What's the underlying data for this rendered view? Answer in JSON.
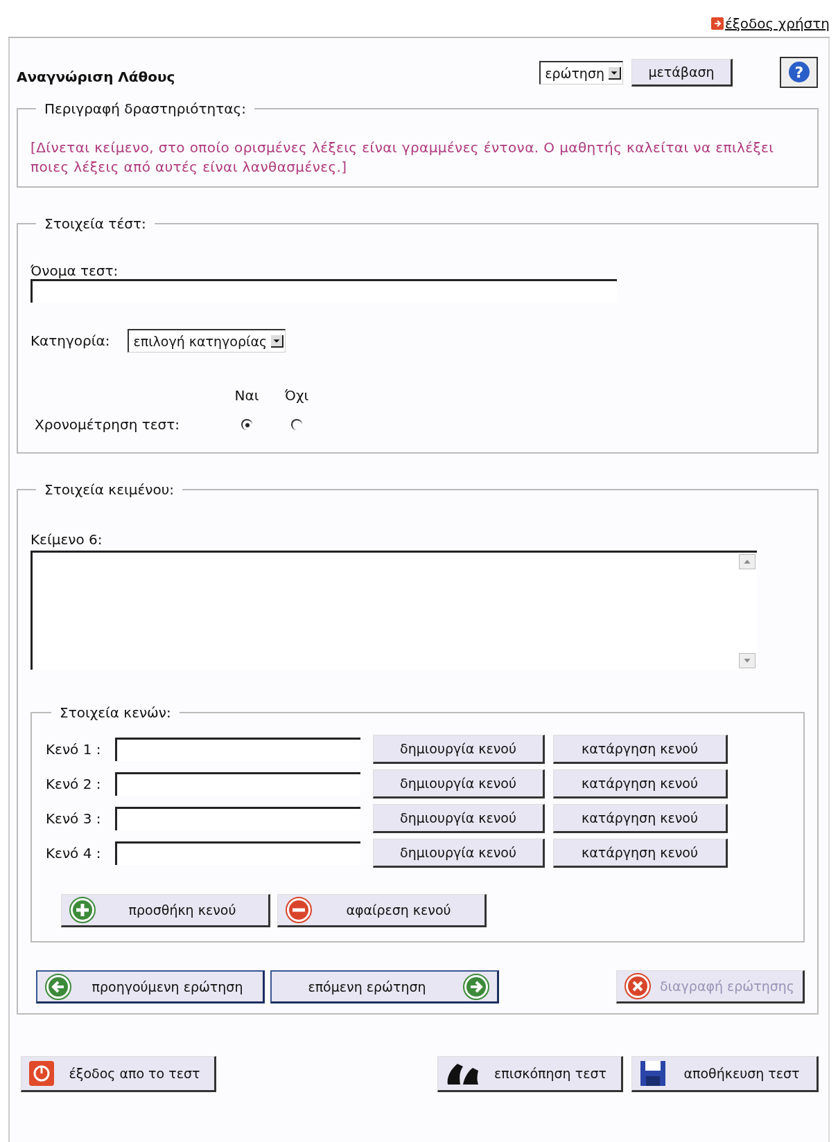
{
  "logout_link": "έξοδος χρήστη",
  "title": "Αναγνώριση Λάθους",
  "nav": {
    "select_value": "ερώτηση",
    "go_button": "μετάβαση",
    "help_button": "?"
  },
  "description": {
    "legend": "Περιγραφή δραστηριότητας:",
    "text": "[Δίνεται κείμενο, στο οποίο ορισμένες λέξεις είναι γραμμένες έντονα. Ο μαθητής καλείται να επιλέξει ποιες λέξεις από αυτές είναι λανθασμένες.]"
  },
  "test_details": {
    "legend": "Στοιχεία τέστ:",
    "name_label": "Όνομα τεστ:",
    "category_label": "Κατηγορία:",
    "category_value": "επιλογή κατηγορίας",
    "timing_label": "Χρονομέτρηση τεστ:",
    "timing_options": [
      {
        "label": "Ναι",
        "selected": true
      },
      {
        "label": "Όχι",
        "selected": false
      }
    ]
  },
  "text_details": {
    "legend": "Στοιχεία κειμένου:",
    "text_label": "Κείμενο 6:",
    "blanks": {
      "legend": "Στοιχεία κενών:",
      "rows": [
        {
          "label": "Κενό 1 :",
          "create": "δημιουργία κενού",
          "remove": "κατάργηση κενού"
        },
        {
          "label": "Κενό 2 :",
          "create": "δημιουργία κενού",
          "remove": "κατάργηση κενού"
        },
        {
          "label": "Κενό 3 :",
          "create": "δημιουργία κενού",
          "remove": "κατάργηση κενού"
        },
        {
          "label": "Κενό 4 :",
          "create": "δημιουργία κενού",
          "remove": "κατάργηση κενού"
        }
      ],
      "actions": [
        {
          "label": "προσθήκη κενού",
          "kind": "add"
        },
        {
          "label": "αφαίρεση κενού",
          "kind": "remove"
        }
      ]
    },
    "question_nav": [
      {
        "label": "προηγούμενη ερώτηση",
        "kind": "prev",
        "disabled": false
      },
      {
        "label": "επόμενη ερώτηση",
        "kind": "next",
        "disabled": false
      },
      {
        "label": "διαγραφή ερώτησης",
        "kind": "delete",
        "disabled": true
      }
    ]
  },
  "footer": [
    {
      "label": "έξοδος απο το τεστ",
      "kind": "exit"
    },
    {
      "label": "επισκόπηση τεστ",
      "kind": "preview"
    },
    {
      "label": "αποθήκευση τεστ",
      "kind": "save"
    }
  ]
}
